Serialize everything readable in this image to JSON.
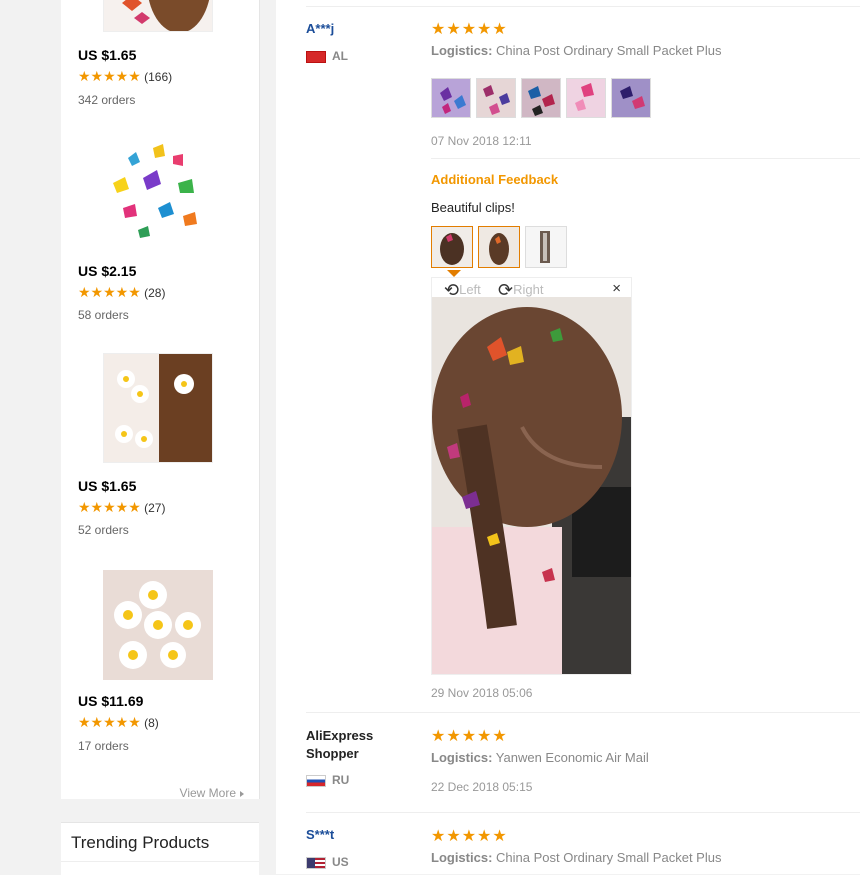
{
  "sidebar": {
    "products": [
      {
        "price": "US $1.65",
        "stars": "★★★★★",
        "reviews": "(166)",
        "orders": "342 orders"
      },
      {
        "price": "US $2.15",
        "stars": "★★★★★",
        "reviews": "(28)",
        "orders": "58 orders"
      },
      {
        "price": "US $1.65",
        "stars": "★★★★★",
        "reviews": "(27)",
        "orders": "52 orders"
      },
      {
        "price": "US $11.69",
        "stars": "★★★★★",
        "reviews": "(8)",
        "orders": "17 orders"
      }
    ],
    "view_more": "View More",
    "trending_title": "Trending Products"
  },
  "feedback": [
    {
      "user": "A***j",
      "country": "AL",
      "stars": "★★★★★",
      "logistics_label": "Logistics:",
      "logistics": "China Post Ordinary Small Packet Plus",
      "date": "07 Nov 2018 12:11",
      "additional_title": "Additional Feedback",
      "additional_text": "Beautiful clips!",
      "additional_date": "29 Nov 2018 05:06",
      "viewer": {
        "rotate_left": "Left",
        "rotate_right": "Right",
        "close": "×"
      }
    },
    {
      "user_line1": "AliExpress",
      "user_line2": "Shopper",
      "country": "RU",
      "stars": "★★★★★",
      "logistics_label": "Logistics:",
      "logistics": "Yanwen Economic Air Mail",
      "date": "22 Dec 2018 05:15"
    },
    {
      "user": "S***t",
      "country": "US",
      "stars": "★★★★★",
      "logistics_label": "Logistics:",
      "logistics": "China Post Ordinary Small Packet Plus"
    }
  ],
  "colors": {
    "accent": "#f29700",
    "link": "#1b4d99"
  }
}
